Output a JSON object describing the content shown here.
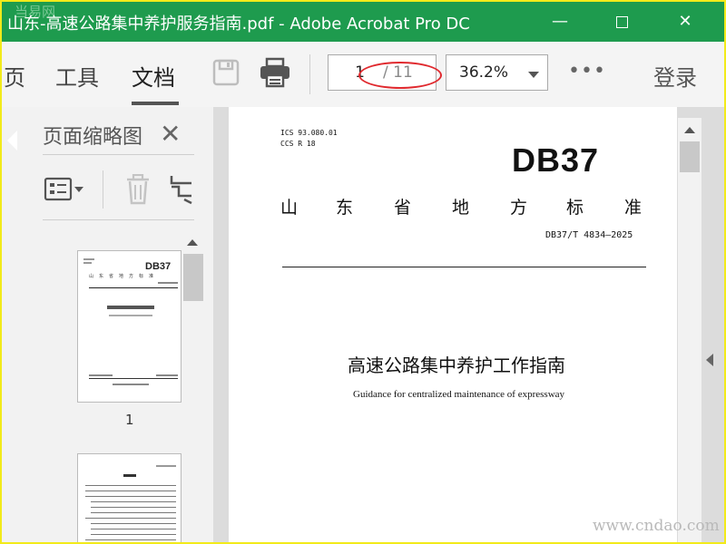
{
  "window": {
    "title": "山东-高速公路集中养护服务指南.pdf - Adobe Acrobat Pro DC",
    "minimize_glyph": "—",
    "close_glyph": "✕",
    "brand_color": "#1e9b4e"
  },
  "watermark_top": "当易网",
  "toolbar": {
    "tabs": [
      "页",
      "工具",
      "文档"
    ],
    "active_tab": "文档",
    "save_icon": "save-icon",
    "print_icon": "print-icon",
    "page_current": "1",
    "page_total": "/ 11",
    "zoom": "36.2%",
    "more": "•••",
    "login": "登录"
  },
  "sidebar": {
    "title": "页面缩略图",
    "close_glyph": "✕",
    "options_icon": "thumbnail-options-icon",
    "delete_icon": "trash-icon",
    "extract_icon": "crop-icon",
    "thumb1_number": "1"
  },
  "document": {
    "ics": "ICS  93.080.01",
    "ccs": "CCS  R 18",
    "db_label": "DB37",
    "province_standard": [
      "山",
      "东",
      "省",
      "地",
      "方",
      "标",
      "准"
    ],
    "standard_number": "DB37/T 4834—2025",
    "title_cn": "高速公路集中养护工作指南",
    "title_en": "Guidance for centralized maintenance of expressway"
  },
  "footer_watermark": "www.cndao.com"
}
